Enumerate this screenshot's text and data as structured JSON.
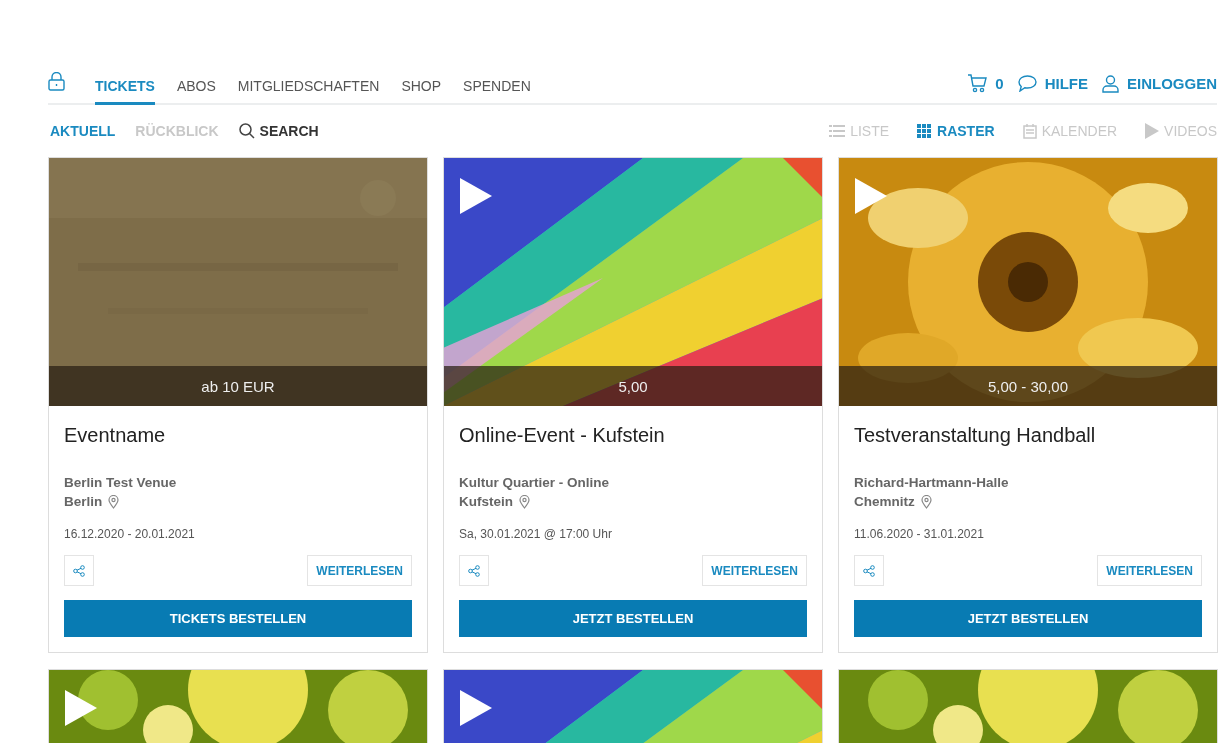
{
  "nav": {
    "tabs": [
      {
        "label": "TICKETS",
        "selected": true
      },
      {
        "label": "ABOS",
        "selected": false
      },
      {
        "label": "MITGLIEDSCHAFTEN",
        "selected": false
      },
      {
        "label": "SHOP",
        "selected": false
      },
      {
        "label": "SPENDEN",
        "selected": false
      }
    ],
    "cart_count": "0",
    "help": "HILFE",
    "login": "EINLOGGEN"
  },
  "subnav": {
    "filters": [
      {
        "label": "AKTUELL",
        "selected": true
      },
      {
        "label": "RÜCKBLICK",
        "selected": false
      }
    ],
    "search": "SEARCH",
    "views": [
      {
        "kind": "list",
        "label": "LISTE",
        "selected": false
      },
      {
        "kind": "grid",
        "label": "RASTER",
        "selected": true
      },
      {
        "kind": "calendar",
        "label": "KALENDER",
        "selected": false
      },
      {
        "kind": "video",
        "label": "VIDEOS",
        "selected": false
      }
    ]
  },
  "cards": [
    {
      "price": "ab 10 EUR",
      "title": "Eventname",
      "venue": "Berlin Test Venue",
      "city": "Berlin",
      "date": "16.12.2020 - 20.01.2021",
      "read_more": "WEITERLESEN",
      "order": "TICKETS BESTELLEN",
      "video": false
    },
    {
      "price": "5,00",
      "title": "Online-Event - Kufstein",
      "venue": "Kultur Quartier - Online",
      "city": "Kufstein",
      "date": "Sa, 30.01.2021 @ 17:00 Uhr",
      "read_more": "WEITERLESEN",
      "order": "JETZT BESTELLEN",
      "video": true
    },
    {
      "price": "5,00 - 30,00",
      "title": "Testveranstaltung Handball",
      "venue": "Richard-Hartmann-Halle",
      "city": "Chemnitz",
      "date": "11.06.2020 - 31.01.2021",
      "read_more": "WEITERLESEN",
      "order": "JETZT BESTELLEN",
      "video": true
    }
  ],
  "more_cards": [
    {
      "video": true
    },
    {
      "video": true
    },
    {
      "video": false
    }
  ]
}
